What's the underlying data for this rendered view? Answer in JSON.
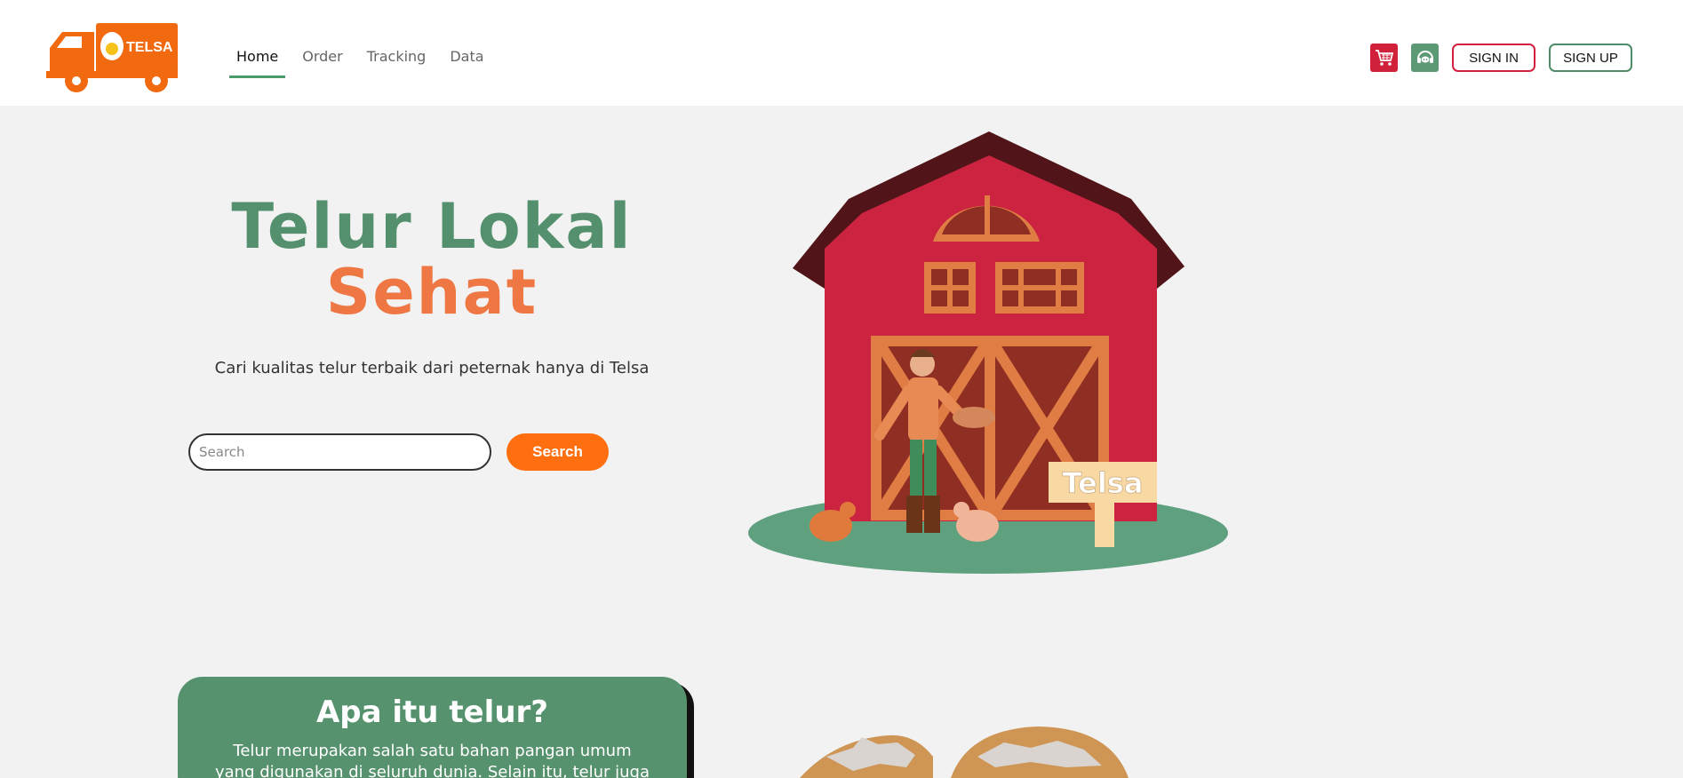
{
  "brand": {
    "name": "TELSA"
  },
  "nav": {
    "items": [
      {
        "label": "Home",
        "active": true
      },
      {
        "label": "Order",
        "active": false
      },
      {
        "label": "Tracking",
        "active": false
      },
      {
        "label": "Data",
        "active": false
      }
    ]
  },
  "header": {
    "cart_icon": "cart-icon",
    "support_icon": "headset-icon",
    "signin_label": "SIGN IN",
    "signup_label": "SIGN UP"
  },
  "hero": {
    "title_line1": "Telur Lokal",
    "title_line2": "Sehat",
    "subtitle": "Cari kualitas telur terbaik dari peternak hanya di Telsa",
    "search_placeholder": "Search",
    "search_button": "Search",
    "sign_text": "Telsa"
  },
  "info": {
    "title": "Apa itu telur?",
    "text": "Telur merupakan salah satu bahan pangan umum yang digunakan di seluruh dunia. Selain itu, telur juga sumber"
  },
  "colors": {
    "accent_green": "#57926e",
    "accent_orange": "#ff6f0f",
    "title_orange": "#ee7743",
    "cart_red": "#d0203a"
  }
}
